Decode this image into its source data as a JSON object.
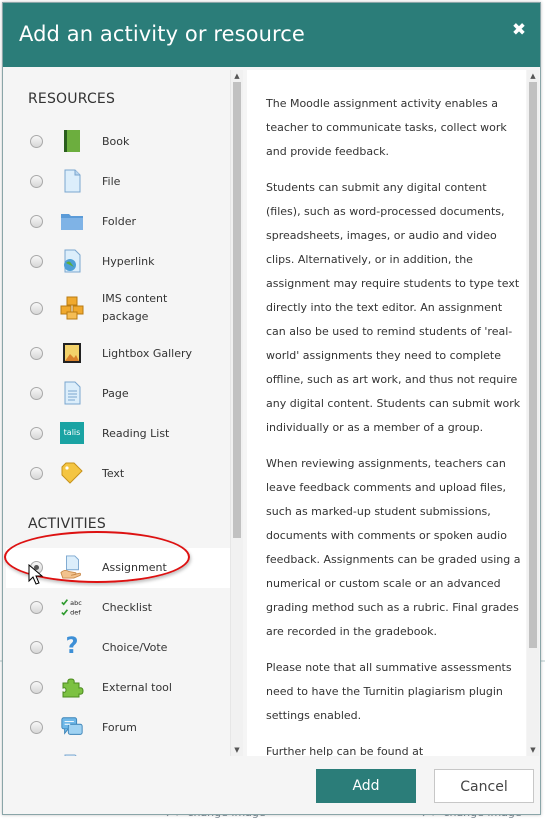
{
  "dialog": {
    "title": "Add an activity or resource",
    "close_icon": "close-icon"
  },
  "resources": {
    "heading": "RESOURCES",
    "items": [
      {
        "label": "Book",
        "icon": "book-icon"
      },
      {
        "label": "File",
        "icon": "file-icon"
      },
      {
        "label": "Folder",
        "icon": "folder-icon"
      },
      {
        "label": "Hyperlink",
        "icon": "globe-page-icon"
      },
      {
        "label": "IMS content package",
        "icon": "package-icon"
      },
      {
        "label": "Lightbox Gallery",
        "icon": "image-gallery-icon"
      },
      {
        "label": "Page",
        "icon": "page-icon"
      },
      {
        "label": "Reading List",
        "icon": "talis-icon",
        "badge": "talis"
      },
      {
        "label": "Text",
        "icon": "tag-icon"
      }
    ]
  },
  "activities": {
    "heading": "ACTIVITIES",
    "items": [
      {
        "label": "Assignment",
        "icon": "assignment-icon",
        "selected": true
      },
      {
        "label": "Checklist",
        "icon": "checklist-icon",
        "badge_top": "abc",
        "badge_bottom": "def"
      },
      {
        "label": "Choice/Vote",
        "icon": "question-icon"
      },
      {
        "label": "External tool",
        "icon": "puzzle-icon"
      },
      {
        "label": "Forum",
        "icon": "forum-icon"
      }
    ]
  },
  "description": {
    "paragraphs": [
      "The Moodle assignment activity enables a teacher to communicate tasks, collect work and provide feedback.",
      "Students can submit any digital content (files), such as word-processed documents, spreadsheets, images, or audio and video clips. Alternatively, or in addition, the assignment may require students to type text directly into the text editor. An assignment can also be used to remind students of 'real-world' assignments they need to complete offline, such as art work, and thus not require any digital content. Students can submit work individually or as a member of a group.",
      "When reviewing assignments, teachers can leave feedback comments and upload files, such as marked-up student submissions, documents with comments or spoken audio feedback. Assignments can be graded using a numerical or custom scale or an advanced grading method such as a rubric. Final grades are recorded in the gradebook.",
      "Please note that all summative assessments need to have the Turnitin plagiarism plugin settings enabled.",
      "Further help can be found at"
    ]
  },
  "footer": {
    "add_label": "Add",
    "cancel_label": "Cancel"
  },
  "background": {
    "footer_left": "↳ ↗ change image",
    "footer_right": "↳ ↗ change image"
  },
  "colors": {
    "header_bg": "#2b7d79",
    "add_button_bg": "#2b7d79",
    "highlight_ellipse": "#d11111"
  }
}
